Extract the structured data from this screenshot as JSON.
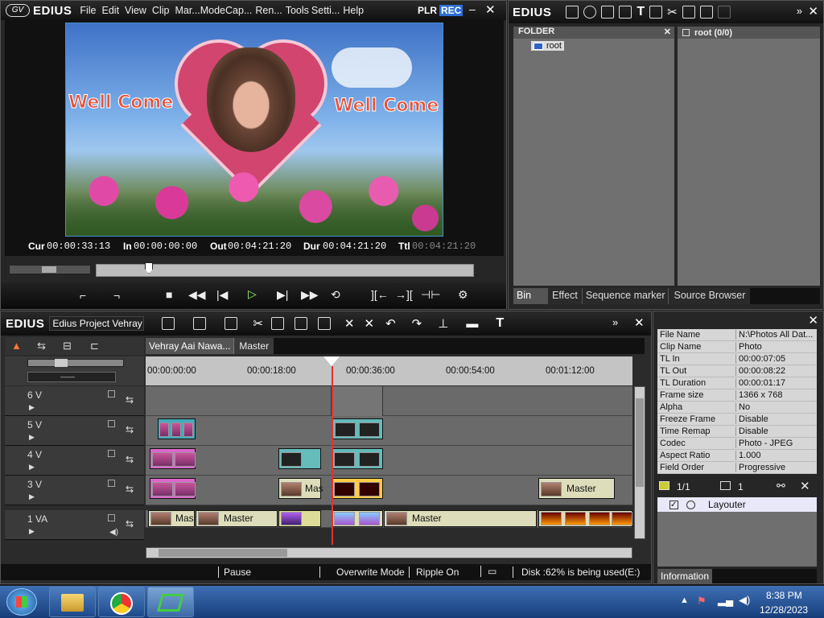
{
  "player": {
    "logo": "EDIUS",
    "menu": [
      "File",
      "Edit",
      "View",
      "Clip",
      "Mar...",
      "Mode",
      "Cap...",
      "Ren...",
      "Tools",
      "Setti...",
      "Help"
    ],
    "plr": "PLR",
    "rec": "REC",
    "preview_texts": [
      "Well Come",
      "Well Come"
    ],
    "timecodes": {
      "cur_label": "Cur",
      "cur": "00:00:33:13",
      "in_label": "In",
      "in": "00:00:00:00",
      "out_label": "Out",
      "out": "00:04:21:20",
      "dur_label": "Dur",
      "dur": "00:04:21:20",
      "ttl_label": "Ttl",
      "ttl": "00:04:21:20"
    }
  },
  "bin": {
    "logo": "EDIUS",
    "folder_header": "FOLDER",
    "root_item": "root",
    "root_count": "root (0/0)",
    "tabs": [
      "Bin",
      "Effect",
      "Sequence marker",
      "Source Browser"
    ]
  },
  "timeline": {
    "logo": "EDIUS",
    "project": "Edius Project Vehray ...",
    "seq_tabs": [
      "Vehray Aai Nawa...",
      "Master"
    ],
    "ruler": [
      "00:00:00:00",
      "00:00:18:00",
      "00:00:36:00",
      "00:00:54:00",
      "00:01:12:00"
    ],
    "tracks": [
      "6 V",
      "5 V",
      "4 V",
      "3 V",
      "1 VA"
    ],
    "clip_labels": {
      "master_3v": "Master",
      "mas_3v": "Mas",
      "mas_1va": "Mas",
      "master_1va_a": "Master",
      "master_1va_b": "Master"
    }
  },
  "info": {
    "rows": [
      {
        "k": "File Name",
        "v": "N:\\Photos All Dat..."
      },
      {
        "k": "Clip Name",
        "v": "Photo"
      },
      {
        "k": "TL In",
        "v": "00:00:07:05"
      },
      {
        "k": "TL Out",
        "v": "00:00:08:22"
      },
      {
        "k": "TL Duration",
        "v": "00:00:01:17"
      },
      {
        "k": "Frame size",
        "v": "1366 x 768"
      },
      {
        "k": "Alpha",
        "v": "No"
      },
      {
        "k": "Freeze Frame",
        "v": "Disable"
      },
      {
        "k": "Time Remap",
        "v": "Disable"
      },
      {
        "k": "Codec",
        "v": "Photo - JPEG"
      },
      {
        "k": "Aspect Ratio",
        "v": "1.000"
      },
      {
        "k": "Field Order",
        "v": "Progressive"
      }
    ],
    "page": "1/1",
    "count": "1",
    "effect": "Layouter",
    "tab": "Information"
  },
  "status": {
    "state": "Pause",
    "mode": "Overwrite Mode",
    "ripple": "Ripple On",
    "disk": "Disk :62% is being used(E:)"
  },
  "taskbar": {
    "time": "8:38 PM",
    "date": "12/28/2023"
  }
}
